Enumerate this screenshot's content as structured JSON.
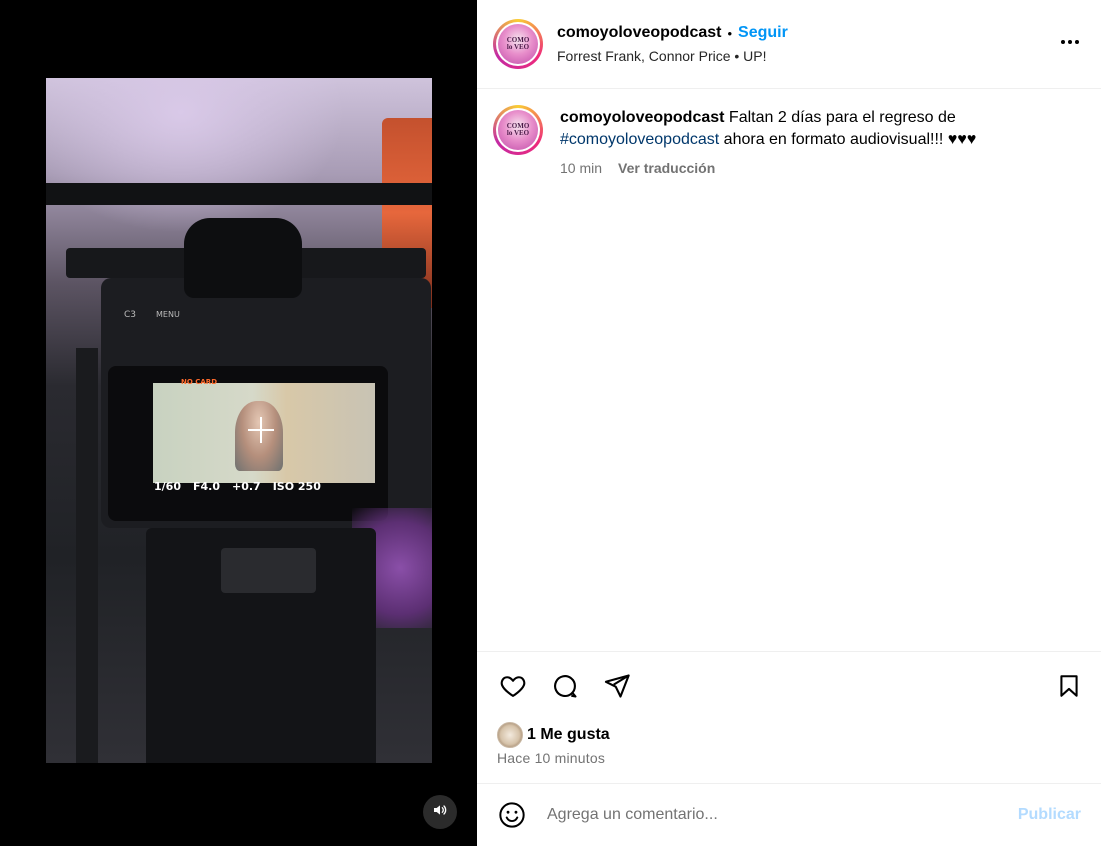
{
  "post": {
    "username": "comoyoloveopodcast",
    "follow_label": "Seguir",
    "separator": "•",
    "audio": "Forrest Frank, Connor Price • UP!",
    "avatar_text": [
      "COMO",
      "lo VEO"
    ]
  },
  "caption": {
    "username": "comoyoloveopodcast",
    "text_before": " Faltan 2 días para el regreso de ",
    "hashtag": "#comoyoloveopodcast",
    "text_after": " ahora en formato audiovisual!!! ♥♥♥",
    "time": "10 min",
    "translate_label": "Ver traducción"
  },
  "media": {
    "camera_labels": {
      "no_card": "NO CARD",
      "shutter": "1/60",
      "aperture": "F4.0",
      "exposure": "+0.7",
      "iso": "ISO 250",
      "c3": "C3",
      "menu": "MENU"
    }
  },
  "engagement": {
    "likes_label": "1 Me gusta",
    "time_ago": "Hace 10 minutos"
  },
  "comment": {
    "placeholder": "Agrega un comentario...",
    "publish_label": "Publicar"
  },
  "icons": {
    "like": "heart-icon",
    "comment": "comment-icon",
    "share": "send-icon",
    "save": "bookmark-icon",
    "emoji": "emoji-icon",
    "sound": "speaker-icon",
    "more": "more-options-icon"
  },
  "colors": {
    "follow": "#0095f6",
    "hashtag": "#00376b",
    "muted_text": "#737373",
    "publish_disabled": "#b3dbff"
  }
}
